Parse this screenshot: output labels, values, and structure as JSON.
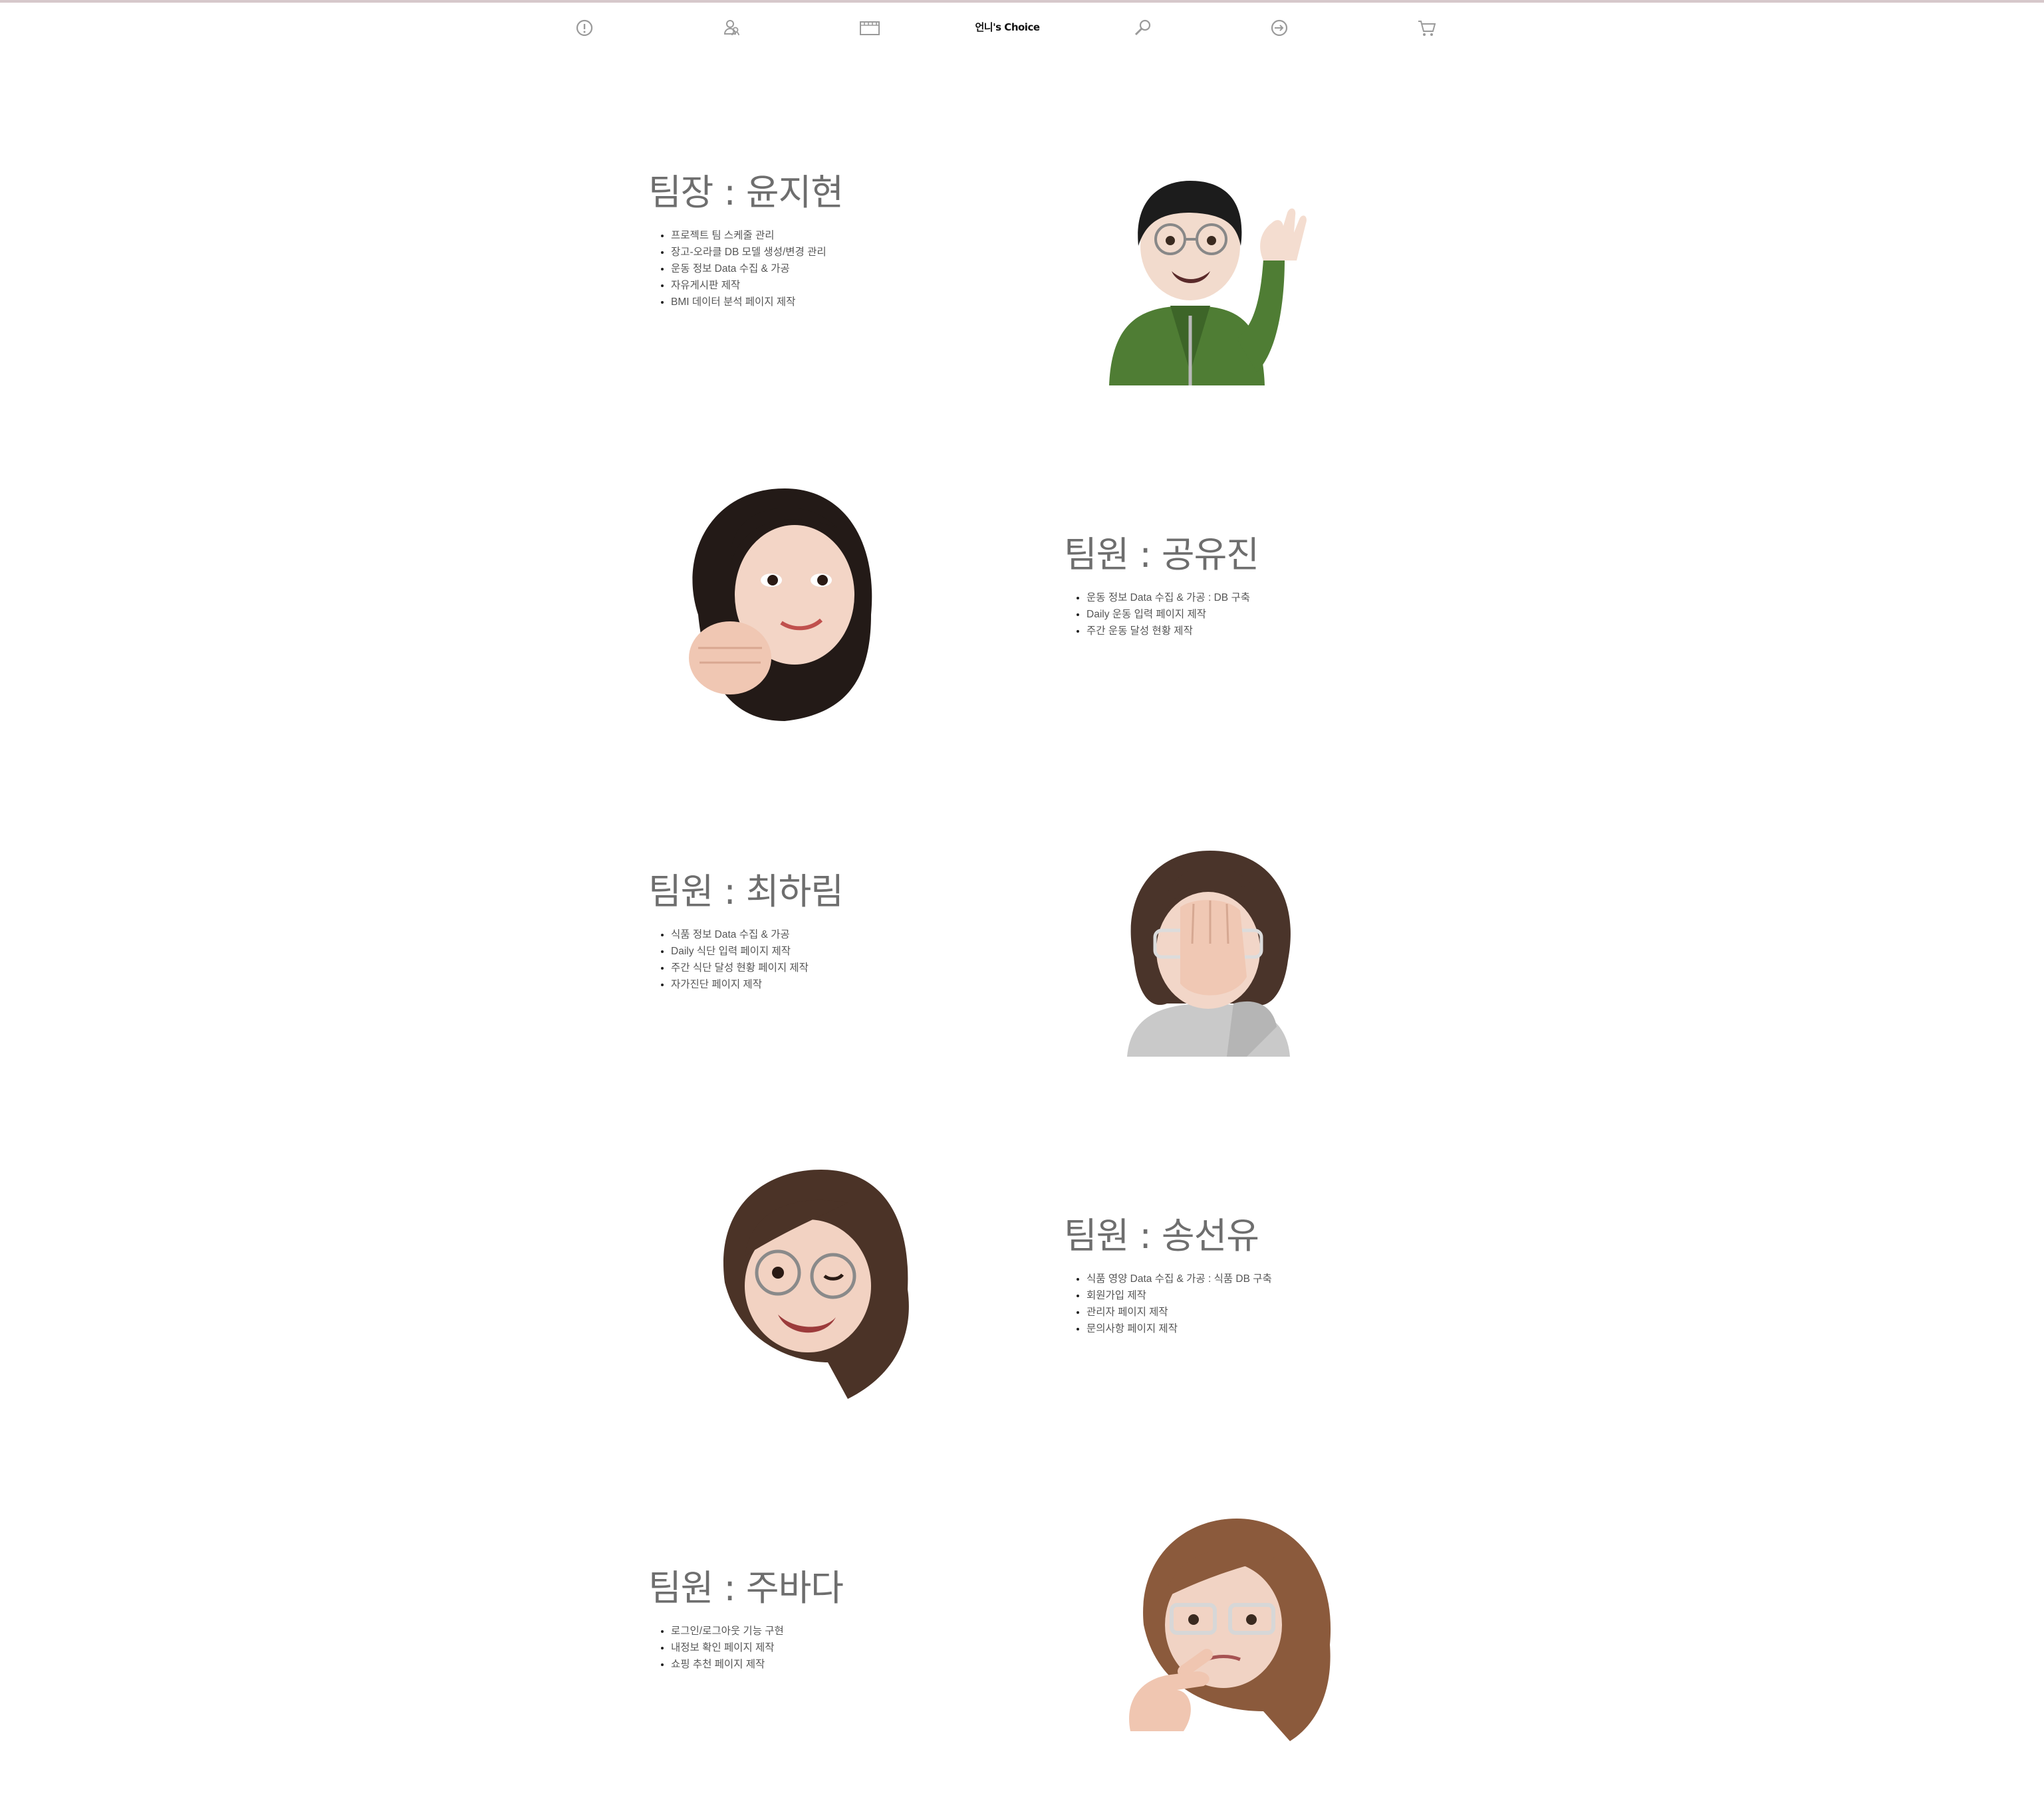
{
  "nav": {
    "brand": "언니's Choice",
    "icons": [
      "info-icon",
      "people-icon",
      "film-icon",
      "search-icon",
      "login-icon",
      "cart-icon"
    ]
  },
  "members": [
    {
      "title": "팀장 : 윤지현",
      "tasks": [
        "프로젝트 팀 스케줄 관리",
        "장고-오라클 DB 모델 생성/변경 관리",
        "운동 정보 Data 수집 & 가공",
        "자유게시판 제작",
        "BMI 데이터 분석 페이지 제작"
      ]
    },
    {
      "title": "팀원 : 공유진",
      "tasks": [
        "운동 정보 Data 수집 & 가공 : DB 구축",
        "Daily 운동 입력 페이지 제작",
        "주간 운동 달성 현황 제작"
      ]
    },
    {
      "title": "팀원 : 최하림",
      "tasks": [
        "식품 정보 Data 수집 & 가공",
        "Daily 식단 입력 페이지 제작",
        "주간 식단 달성 현황 페이지 제작",
        "자가진단 페이지 제작"
      ]
    },
    {
      "title": "팀원 : 송선유",
      "tasks": [
        "식품 영양 Data 수집 & 가공 : 식품 DB 구축",
        "회원가입 제작",
        "관리자 페이지 제작",
        "문의사항 페이지 제작"
      ]
    },
    {
      "title": "팀원 : 주바다",
      "tasks": [
        "로그인/로그아웃 기능 구현",
        "내정보 확인 페이지 제작",
        "쇼핑 추천 페이지 제작"
      ]
    }
  ],
  "colors": {
    "top_line": "#d6c8cb",
    "icon_stroke": "#9a9a9a",
    "title_text": "#6e6e6e",
    "body_text": "#555555"
  }
}
